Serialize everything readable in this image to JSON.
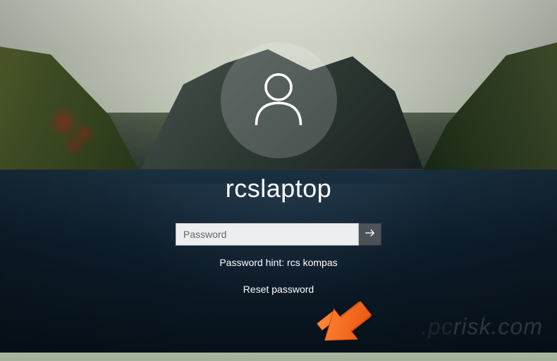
{
  "login": {
    "username": "rcslaptop",
    "password_placeholder": "Password",
    "password_value": "",
    "hint_label": "Password hint: rcs kompas",
    "reset_link": "Reset password"
  },
  "icons": {
    "avatar": "user-icon",
    "submit": "arrow-right-icon"
  },
  "annotation": {
    "arrow_color": "#ff6a1a",
    "target": "reset-password-link"
  },
  "watermark": "risk.com"
}
